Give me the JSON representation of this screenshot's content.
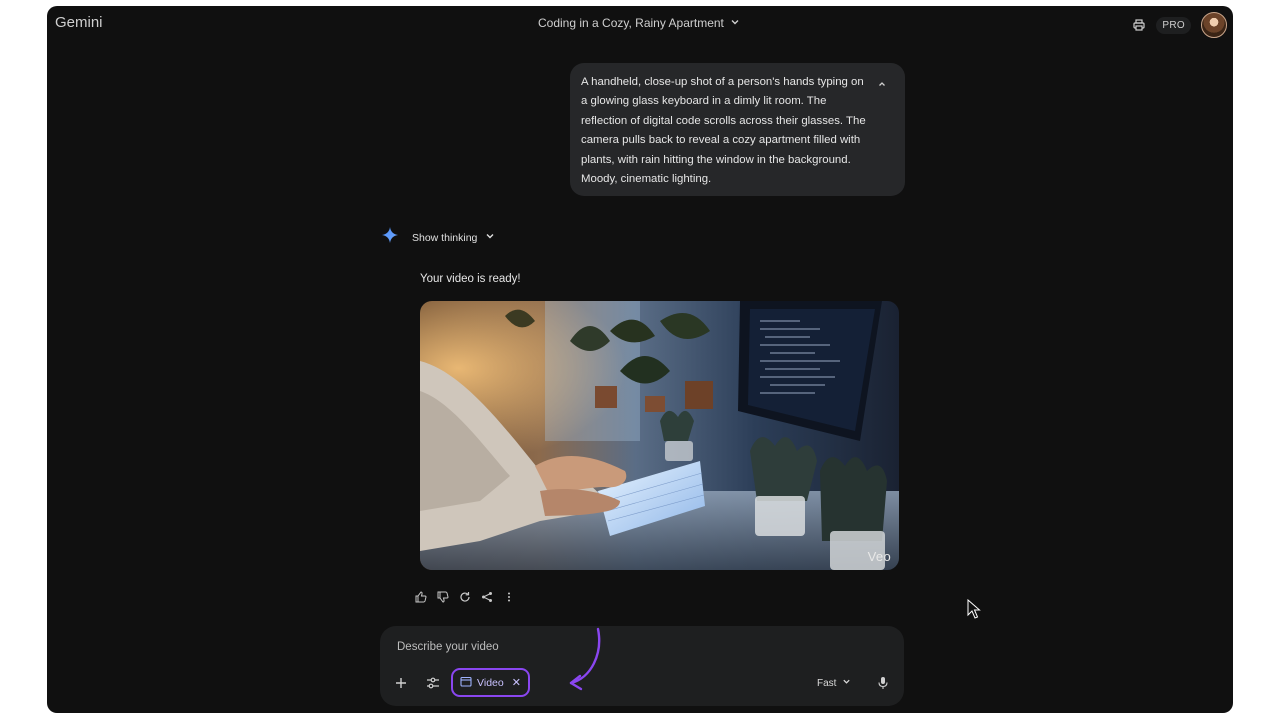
{
  "app": {
    "brand": "Gemini",
    "chat_title": "Coding in a Cozy, Rainy Apartment"
  },
  "header": {
    "pro_badge": "PRO"
  },
  "user_prompt": "A handheld, close-up shot of a person's hands typing on a glowing glass keyboard in a dimly lit room. The reflection of digital code scrolls across their glasses. The camera pulls back to reveal a cozy apartment filled with plants, with rain hitting the window in the background. Moody, cinematic lighting.",
  "response": {
    "show_thinking_label": "Show thinking",
    "message": "Your video is ready!",
    "video_watermark": "Veo"
  },
  "composer": {
    "placeholder": "Describe your video",
    "chip_label": "Video",
    "mode_label": "Fast"
  },
  "colors": {
    "background": "#101010",
    "bubble": "#262729",
    "accent": "#8a46f0",
    "composer": "#1e1f20"
  },
  "icons": [
    "chevron-down-icon",
    "printer-icon",
    "avatar",
    "chevron-up-icon",
    "gemini-sparkle-icon",
    "thumbs-up-icon",
    "thumbs-down-icon",
    "regenerate-icon",
    "share-icon",
    "more-vert-icon",
    "plus-icon",
    "tools-icon",
    "calendar-video-icon",
    "close-icon",
    "mic-icon",
    "arrow-annotation",
    "mouse-cursor-icon"
  ]
}
